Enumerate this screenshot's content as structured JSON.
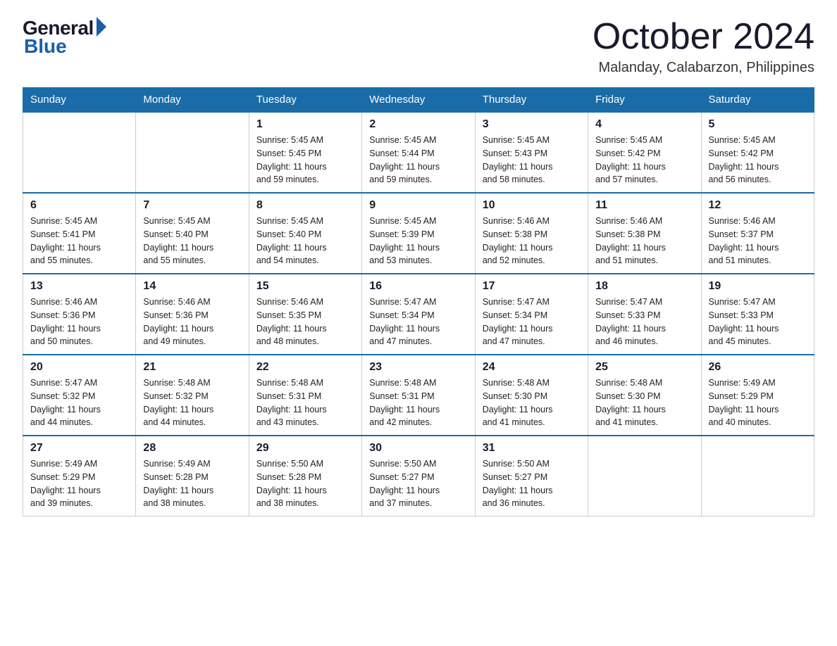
{
  "logo": {
    "general": "General",
    "blue": "Blue"
  },
  "title": "October 2024",
  "location": "Malanday, Calabarzon, Philippines",
  "days_of_week": [
    "Sunday",
    "Monday",
    "Tuesday",
    "Wednesday",
    "Thursday",
    "Friday",
    "Saturday"
  ],
  "weeks": [
    [
      {
        "day": "",
        "info": ""
      },
      {
        "day": "",
        "info": ""
      },
      {
        "day": "1",
        "info": "Sunrise: 5:45 AM\nSunset: 5:45 PM\nDaylight: 11 hours\nand 59 minutes."
      },
      {
        "day": "2",
        "info": "Sunrise: 5:45 AM\nSunset: 5:44 PM\nDaylight: 11 hours\nand 59 minutes."
      },
      {
        "day": "3",
        "info": "Sunrise: 5:45 AM\nSunset: 5:43 PM\nDaylight: 11 hours\nand 58 minutes."
      },
      {
        "day": "4",
        "info": "Sunrise: 5:45 AM\nSunset: 5:42 PM\nDaylight: 11 hours\nand 57 minutes."
      },
      {
        "day": "5",
        "info": "Sunrise: 5:45 AM\nSunset: 5:42 PM\nDaylight: 11 hours\nand 56 minutes."
      }
    ],
    [
      {
        "day": "6",
        "info": "Sunrise: 5:45 AM\nSunset: 5:41 PM\nDaylight: 11 hours\nand 55 minutes."
      },
      {
        "day": "7",
        "info": "Sunrise: 5:45 AM\nSunset: 5:40 PM\nDaylight: 11 hours\nand 55 minutes."
      },
      {
        "day": "8",
        "info": "Sunrise: 5:45 AM\nSunset: 5:40 PM\nDaylight: 11 hours\nand 54 minutes."
      },
      {
        "day": "9",
        "info": "Sunrise: 5:45 AM\nSunset: 5:39 PM\nDaylight: 11 hours\nand 53 minutes."
      },
      {
        "day": "10",
        "info": "Sunrise: 5:46 AM\nSunset: 5:38 PM\nDaylight: 11 hours\nand 52 minutes."
      },
      {
        "day": "11",
        "info": "Sunrise: 5:46 AM\nSunset: 5:38 PM\nDaylight: 11 hours\nand 51 minutes."
      },
      {
        "day": "12",
        "info": "Sunrise: 5:46 AM\nSunset: 5:37 PM\nDaylight: 11 hours\nand 51 minutes."
      }
    ],
    [
      {
        "day": "13",
        "info": "Sunrise: 5:46 AM\nSunset: 5:36 PM\nDaylight: 11 hours\nand 50 minutes."
      },
      {
        "day": "14",
        "info": "Sunrise: 5:46 AM\nSunset: 5:36 PM\nDaylight: 11 hours\nand 49 minutes."
      },
      {
        "day": "15",
        "info": "Sunrise: 5:46 AM\nSunset: 5:35 PM\nDaylight: 11 hours\nand 48 minutes."
      },
      {
        "day": "16",
        "info": "Sunrise: 5:47 AM\nSunset: 5:34 PM\nDaylight: 11 hours\nand 47 minutes."
      },
      {
        "day": "17",
        "info": "Sunrise: 5:47 AM\nSunset: 5:34 PM\nDaylight: 11 hours\nand 47 minutes."
      },
      {
        "day": "18",
        "info": "Sunrise: 5:47 AM\nSunset: 5:33 PM\nDaylight: 11 hours\nand 46 minutes."
      },
      {
        "day": "19",
        "info": "Sunrise: 5:47 AM\nSunset: 5:33 PM\nDaylight: 11 hours\nand 45 minutes."
      }
    ],
    [
      {
        "day": "20",
        "info": "Sunrise: 5:47 AM\nSunset: 5:32 PM\nDaylight: 11 hours\nand 44 minutes."
      },
      {
        "day": "21",
        "info": "Sunrise: 5:48 AM\nSunset: 5:32 PM\nDaylight: 11 hours\nand 44 minutes."
      },
      {
        "day": "22",
        "info": "Sunrise: 5:48 AM\nSunset: 5:31 PM\nDaylight: 11 hours\nand 43 minutes."
      },
      {
        "day": "23",
        "info": "Sunrise: 5:48 AM\nSunset: 5:31 PM\nDaylight: 11 hours\nand 42 minutes."
      },
      {
        "day": "24",
        "info": "Sunrise: 5:48 AM\nSunset: 5:30 PM\nDaylight: 11 hours\nand 41 minutes."
      },
      {
        "day": "25",
        "info": "Sunrise: 5:48 AM\nSunset: 5:30 PM\nDaylight: 11 hours\nand 41 minutes."
      },
      {
        "day": "26",
        "info": "Sunrise: 5:49 AM\nSunset: 5:29 PM\nDaylight: 11 hours\nand 40 minutes."
      }
    ],
    [
      {
        "day": "27",
        "info": "Sunrise: 5:49 AM\nSunset: 5:29 PM\nDaylight: 11 hours\nand 39 minutes."
      },
      {
        "day": "28",
        "info": "Sunrise: 5:49 AM\nSunset: 5:28 PM\nDaylight: 11 hours\nand 38 minutes."
      },
      {
        "day": "29",
        "info": "Sunrise: 5:50 AM\nSunset: 5:28 PM\nDaylight: 11 hours\nand 38 minutes."
      },
      {
        "day": "30",
        "info": "Sunrise: 5:50 AM\nSunset: 5:27 PM\nDaylight: 11 hours\nand 37 minutes."
      },
      {
        "day": "31",
        "info": "Sunrise: 5:50 AM\nSunset: 5:27 PM\nDaylight: 11 hours\nand 36 minutes."
      },
      {
        "day": "",
        "info": ""
      },
      {
        "day": "",
        "info": ""
      }
    ]
  ]
}
